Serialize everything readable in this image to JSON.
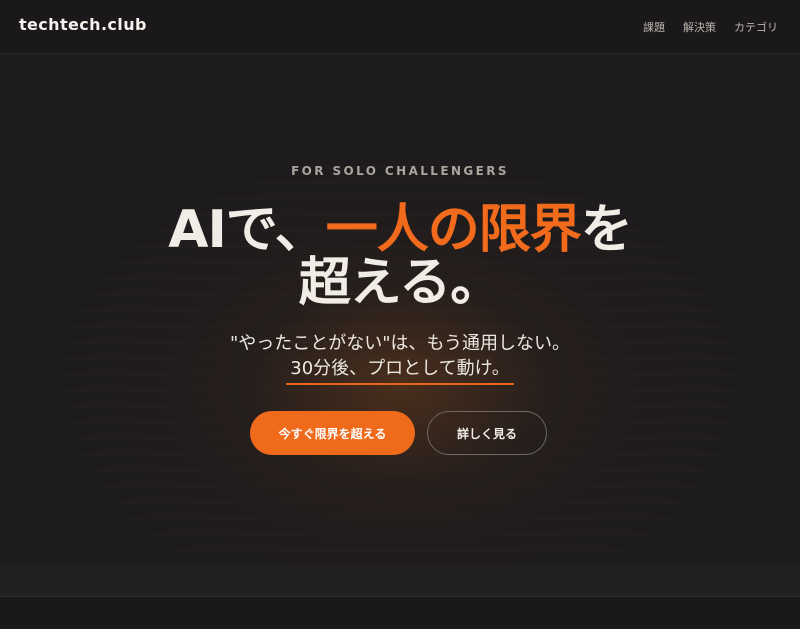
{
  "header": {
    "logo": "techtech.club",
    "nav": [
      "課題",
      "解決策",
      "カテゴリ"
    ]
  },
  "hero": {
    "eyebrow": "FOR SOLO CHALLENGERS",
    "headline_line1_pre": "AIで、",
    "headline_line1_accent": "一人の限界",
    "headline_line1_post": "を",
    "headline_line2": "超える。",
    "sub1": "\"やったことがない\"は、もう通用しない。",
    "sub2": "30分後、プロとして動け。",
    "primary_button": "今すぐ限界を超える",
    "secondary_button": "詳しく見る"
  },
  "colors": {
    "accent": "#f26b1d",
    "background": "#1b191b",
    "text": "#f1ede6"
  }
}
